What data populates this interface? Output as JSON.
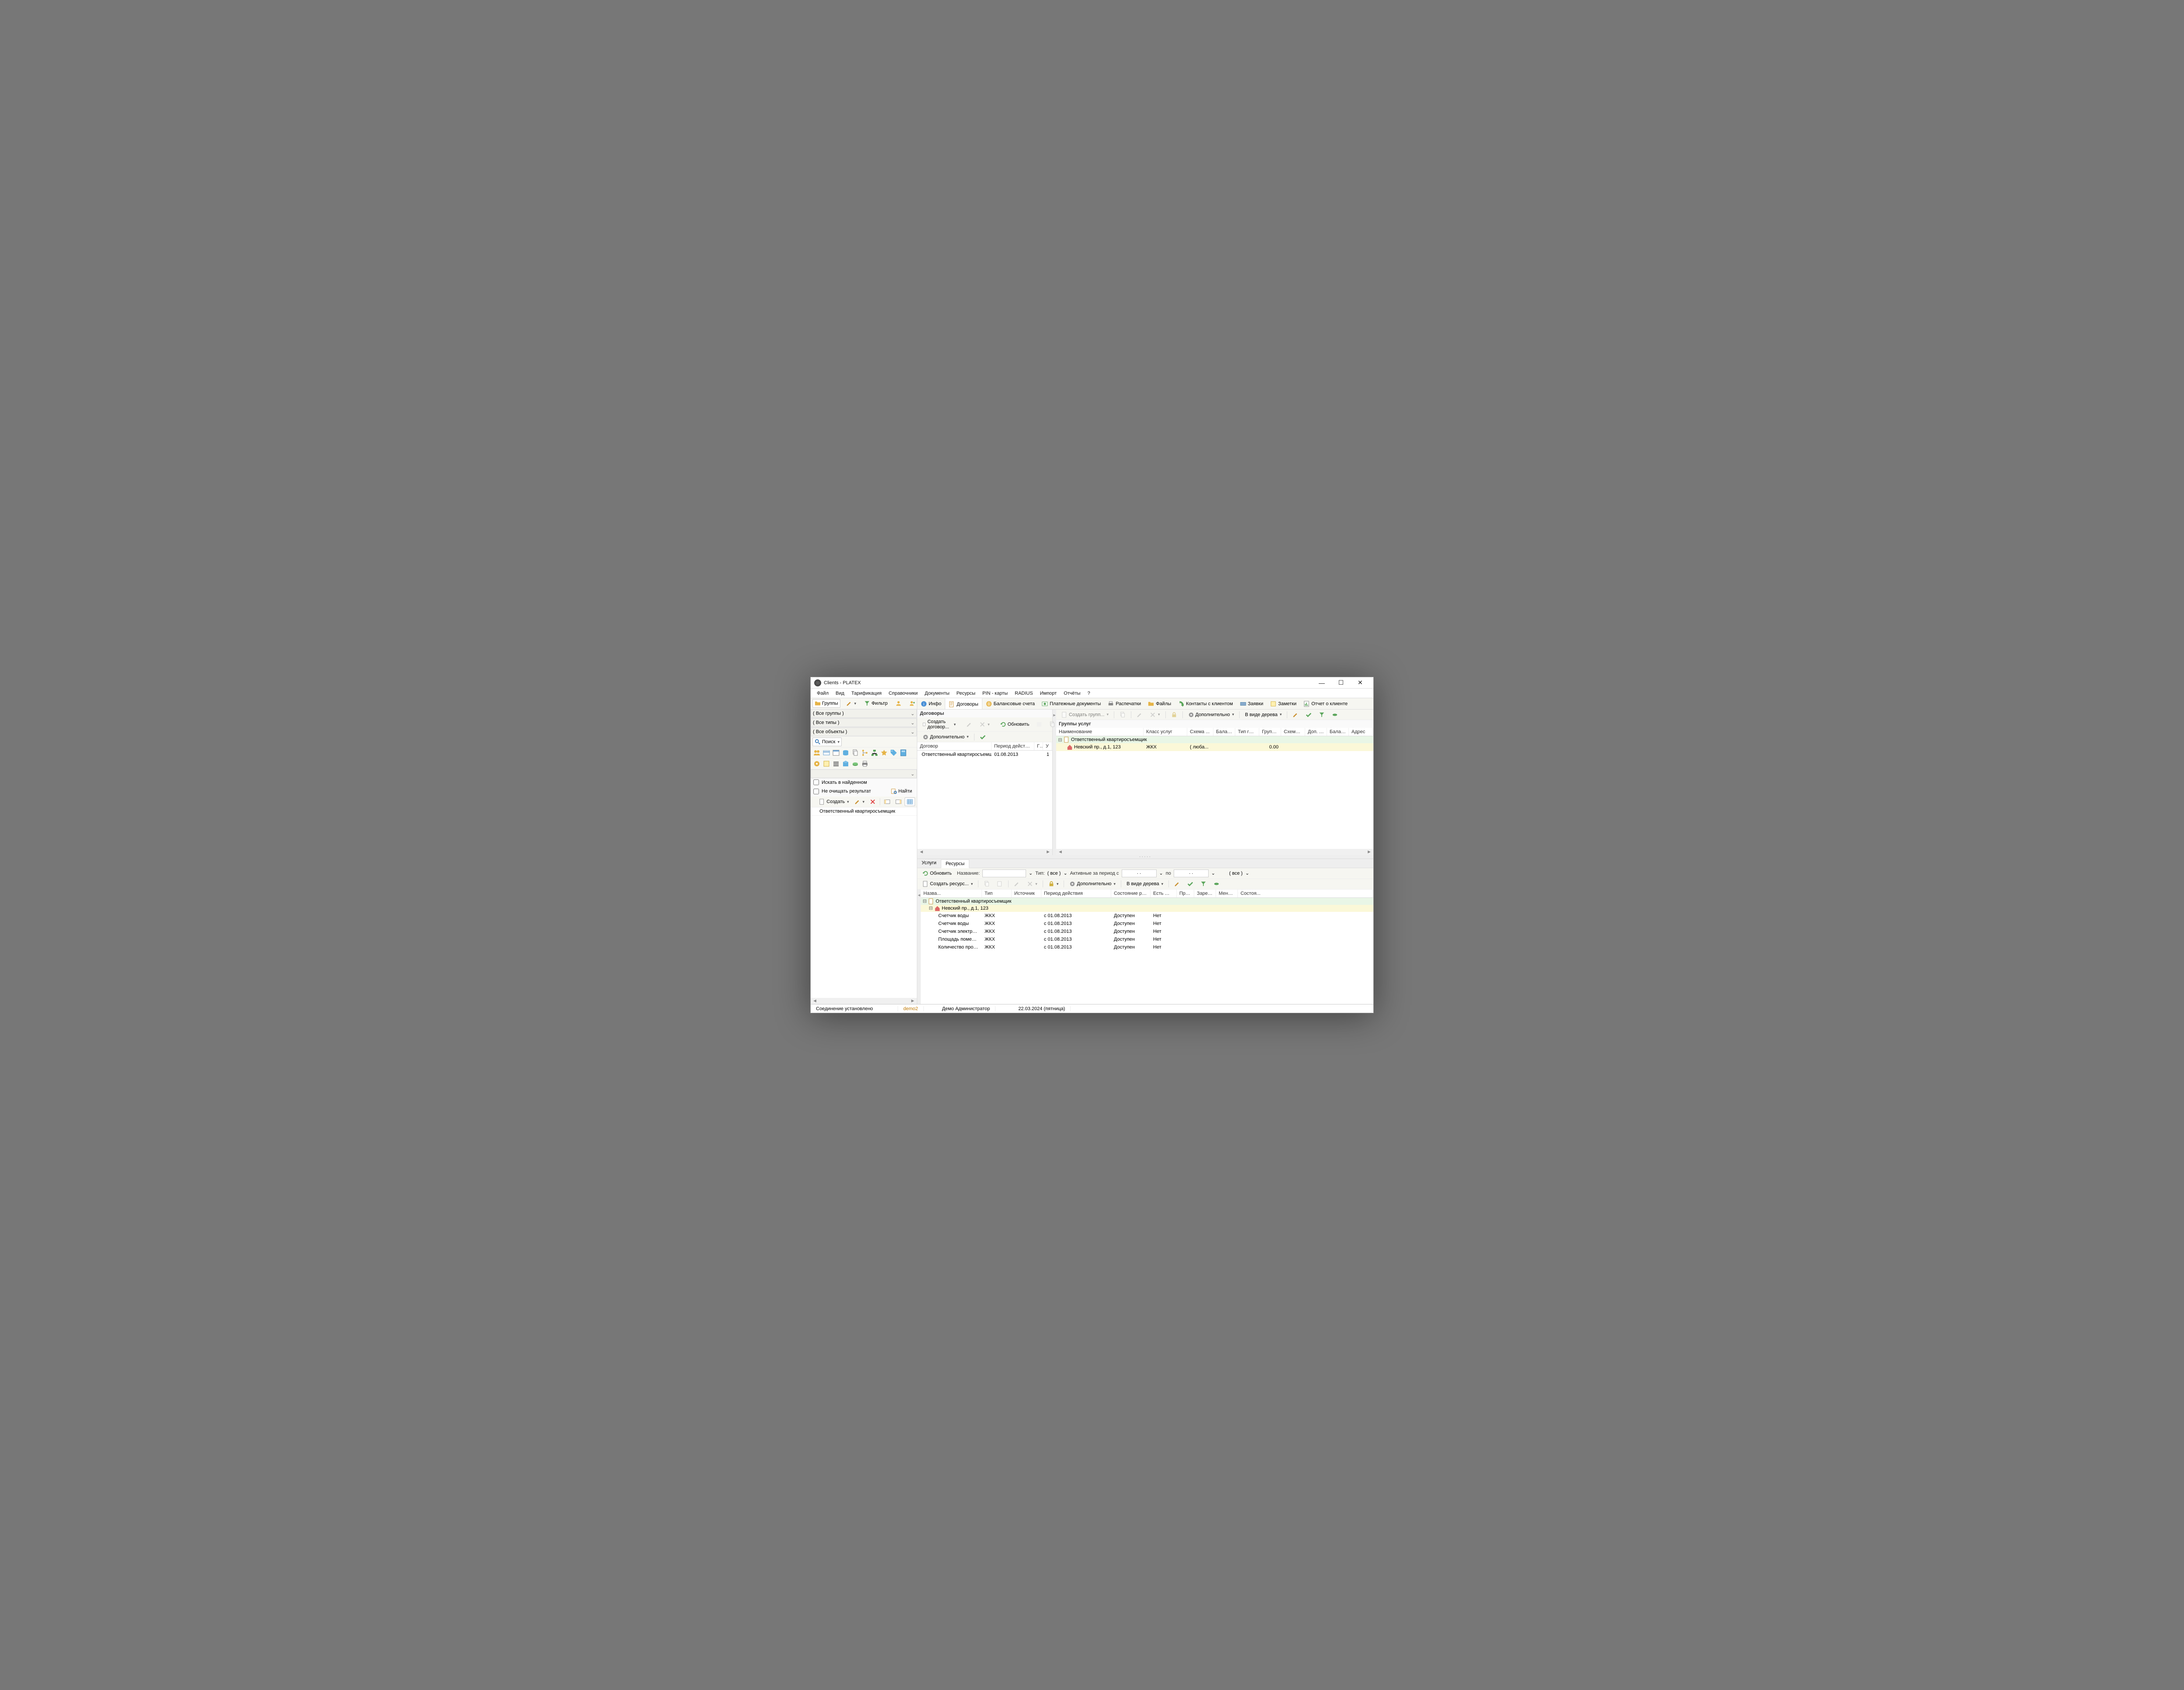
{
  "window": {
    "title": "Clients - PLATEX"
  },
  "menubar": [
    "Файл",
    "Вид",
    "Тарификация",
    "Справочники",
    "Документы",
    "Ресурсы",
    "PIN - карты",
    "RADIUS",
    "Импорт",
    "Отчёты",
    "?"
  ],
  "left": {
    "groups_btn": "Группы",
    "filter_btn": "Фильтр",
    "combo_groups": "( Все группы )",
    "combo_types": "( Все типы )",
    "combo_objects": "( Все объекты )",
    "search_btn": "Поиск",
    "chk_search_in_found": "Искать в найденном",
    "chk_keep_result": "Не очищать результат",
    "find_btn": "Найти",
    "create_btn": "Создать",
    "list_item": "Ответственный квартиросъемщик"
  },
  "tabs_top": [
    "Инфо",
    "Договоры",
    "Балансовые счета",
    "Платежные документы",
    "Распечатки",
    "Файлы",
    "Контакты с клиентом",
    "Заявки",
    "Заметки",
    "Отчет о клиенте"
  ],
  "tabs_top_active": 1,
  "contracts": {
    "pane_title": "Договоры",
    "create_btn": "Создать договор...",
    "refresh_btn": "Обновить",
    "more_btn": "Дополнительно",
    "cols": {
      "contract": "Договор",
      "period": "Период действия",
      "gu": "ГУ",
      "u": "У"
    },
    "rows": [
      {
        "contract": "Ответственный квартиросъемщик",
        "period": "01.08.2013",
        "gu": "",
        "u": "1"
      }
    ]
  },
  "service_groups": {
    "toolbar": {
      "create": "Создать групп...",
      "more": "Дополнительно",
      "view": "В виде дерева"
    },
    "pane_title": "Группы услуг",
    "cols": [
      "Наименование",
      "Класс услуг",
      "Схема ...",
      "Баланс",
      "Тип гру...",
      "Групп...",
      "Схема ...",
      "Доп. п...",
      "Балан...",
      "Адрес"
    ],
    "tree": {
      "root": "Ответственный квартиросъемщик",
      "child": {
        "name": "Невский пр., д.1, 123",
        "class": "ЖКХ",
        "scheme": "( люба...",
        "balance": "0.00"
      }
    }
  },
  "tabs_mid": [
    "Услуги",
    "Ресурсы"
  ],
  "tabs_mid_active": 1,
  "resources": {
    "refresh": "Обновить",
    "name_label": "Название:",
    "type_label": "Тип:",
    "type_all": "( все )",
    "active_label": "Активные за период с",
    "date_from": " . .",
    "to_label": "по",
    "date_to": " . .",
    "all2": "( все )",
    "create": "Создать ресурс...",
    "more": "Дополнительно",
    "view": "В виде дерева",
    "cols": [
      "Назва...",
      "Тип",
      "Источник",
      "Период действия",
      "Состояние ресурса",
      "Есть Web-...",
      "При...",
      "Зарезе...",
      "Менед...",
      "Состоя..."
    ],
    "tree_root": "Ответственный квартиросъемщик",
    "tree_child": "Невский пр., д.1, 123",
    "rows": [
      {
        "name": "Счетчик воды",
        "type": "ЖКХ",
        "src": "",
        "period": "с 01.08.2013",
        "state": "Доступен",
        "web": "Нет"
      },
      {
        "name": "Счетчик воды",
        "type": "ЖКХ",
        "src": "",
        "period": "с 01.08.2013",
        "state": "Доступен",
        "web": "Нет"
      },
      {
        "name": "Счетчик электроэне...",
        "type": "ЖКХ",
        "src": "",
        "period": "с 01.08.2013",
        "state": "Доступен",
        "web": "Нет"
      },
      {
        "name": "Площадь помещения",
        "type": "ЖКХ",
        "src": "",
        "period": "с 01.08.2013",
        "state": "Доступен",
        "web": "Нет"
      },
      {
        "name": "Количество прожив...",
        "type": "ЖКХ",
        "src": "",
        "period": "с 01.08.2013",
        "state": "Доступен",
        "web": "Нет"
      }
    ]
  },
  "status": {
    "conn": "Соединение установлено",
    "db": "demo2",
    "user": "Демо Администратор",
    "date": "22.03.2024 (пятница)"
  }
}
